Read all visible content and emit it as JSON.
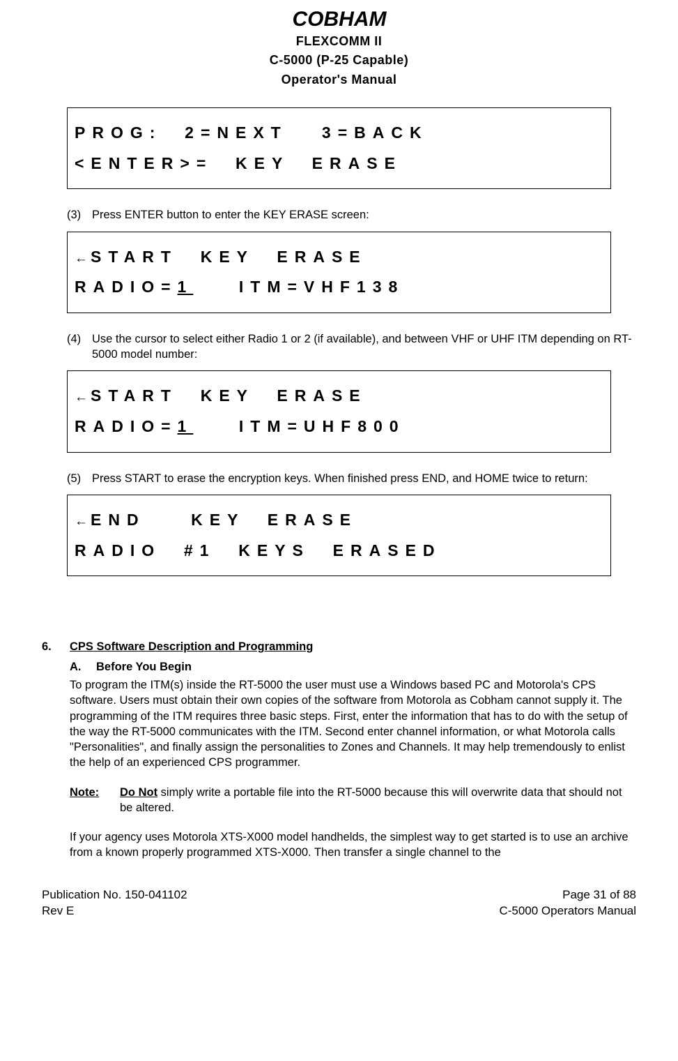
{
  "header": {
    "line1": "FLEXCOMM II",
    "line2": "C-5000 (P-25 Capable)",
    "line3": "Operator's Manual"
  },
  "display1": {
    "line1": "PROG:  2=NEXT   3=BACK",
    "line2": "<ENTER>=  KEY  ERASE   "
  },
  "step3": {
    "num": "(3)",
    "text": "Press ENTER button to enter the KEY ERASE screen:"
  },
  "display2": {
    "arrow": "←",
    "line1_after": "START  KEY  ERASE    ",
    "line2_pre": "RADIO=",
    "line2_cursor": "1",
    "line2_post": "    ITM=VHF138"
  },
  "step4": {
    "num": "(4)",
    "text": "Use the cursor to select either Radio 1 or 2 (if available), and between VHF or UHF ITM depending on RT-5000 model number:"
  },
  "display3": {
    "arrow": "←",
    "line1_after": "START  KEY  ERASE    ",
    "line2_pre": "RADIO=",
    "line2_cursor": "1",
    "line2_post": "    ITM=UHF800"
  },
  "step5": {
    "num": "(5)",
    "text": "Press START to erase the encryption keys.  When finished press END, and HOME twice to return:"
  },
  "display4": {
    "arrow": "←",
    "line1_after": "END    KEY  ERASE    ",
    "line2": "RADIO  #1  KEYS  ERASED"
  },
  "section6": {
    "num": "6.",
    "title": "CPS Software Description and Programming",
    "subA_letter": "A.",
    "subA_title": "Before You Begin",
    "para1": "To program the ITM(s) inside the RT-5000 the user must use a Windows based PC and Motorola's CPS software.  Users must obtain their own copies of the software from Motorola as Cobham cannot supply it. The programming of the ITM requires three basic steps. First, enter the information that has to do with the setup of the way the RT-5000 communicates with the ITM. Second enter channel information, or what Motorola calls \"Personalities\", and finally assign the personalities to Zones and Channels. It may help tremendously to enlist the help of an experienced CPS programmer.",
    "note_label": "Note:",
    "note_donot": "Do Not",
    "note_rest": " simply write a portable file into the RT-5000 because this will overwrite data that should not be altered.",
    "para2": "If your agency uses Motorola XTS-X000 model handhelds, the simplest way to get started is to use an archive from a known properly programmed XTS-X000. Then transfer a single channel to the"
  },
  "footer": {
    "left1": "Publication No. 150-041102",
    "left2": "Rev E",
    "right1": "Page 31 of 88",
    "right2": "C-5000 Operators Manual"
  }
}
